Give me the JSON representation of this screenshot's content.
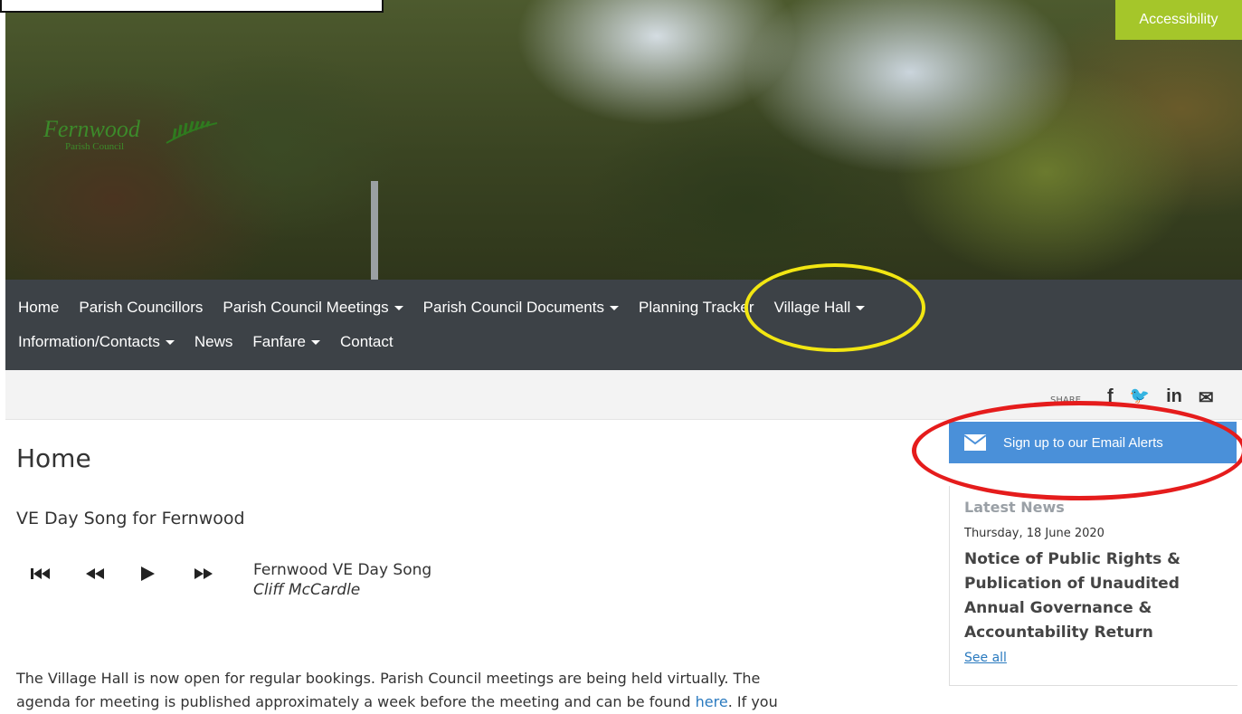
{
  "header": {
    "accessibility_label": "Accessibility",
    "logo_text": "Fernwood",
    "logo_subtext": "Parish Council"
  },
  "nav": {
    "items": [
      {
        "label": "Home"
      },
      {
        "label": "Parish Councillors"
      },
      {
        "label": "Parish Council Meetings"
      },
      {
        "label": "Parish Council Documents"
      },
      {
        "label": "Planning Tracker"
      },
      {
        "label": "Village Hall"
      },
      {
        "label": "Information/Contacts"
      },
      {
        "label": "News"
      },
      {
        "label": "Fanfare"
      },
      {
        "label": "Contact"
      }
    ]
  },
  "share": {
    "label": "SHARE",
    "icons": [
      "facebook-icon",
      "twitter-icon",
      "linkedin-icon",
      "email-icon"
    ],
    "glyphs": [
      "f",
      "🐦",
      "in",
      "✉"
    ]
  },
  "main": {
    "title": "Home",
    "subtitle": "VE Day Song for Fernwood",
    "player": {
      "track": "Fernwood VE Day Song",
      "artist": "Cliff McCardle"
    },
    "body_line1": "The Village Hall is now open for regular bookings. Parish Council meetings are being held virtually. The",
    "body_line2_pre": "agenda for meeting is published approximately a week before the meeting and  can be found ",
    "body_link": "here",
    "body_line2_post": ". If you"
  },
  "sidebar": {
    "email_alerts_label": "Sign up to our Email Alerts",
    "latest_news_heading": "Latest News",
    "news_date": "Thursday, 18 June 2020",
    "news_title": "Notice of Public Rights & Publication of Unaudited Annual Governance & Accountability Return",
    "see_all": "See all"
  },
  "colors": {
    "nav_bg": "#3d4247",
    "accessibility_bg": "#a5c62a",
    "email_btn_bg": "#4a90d9",
    "link": "#2a7abf",
    "annotation_yellow": "#f2e612",
    "annotation_red": "#e51c1c"
  }
}
